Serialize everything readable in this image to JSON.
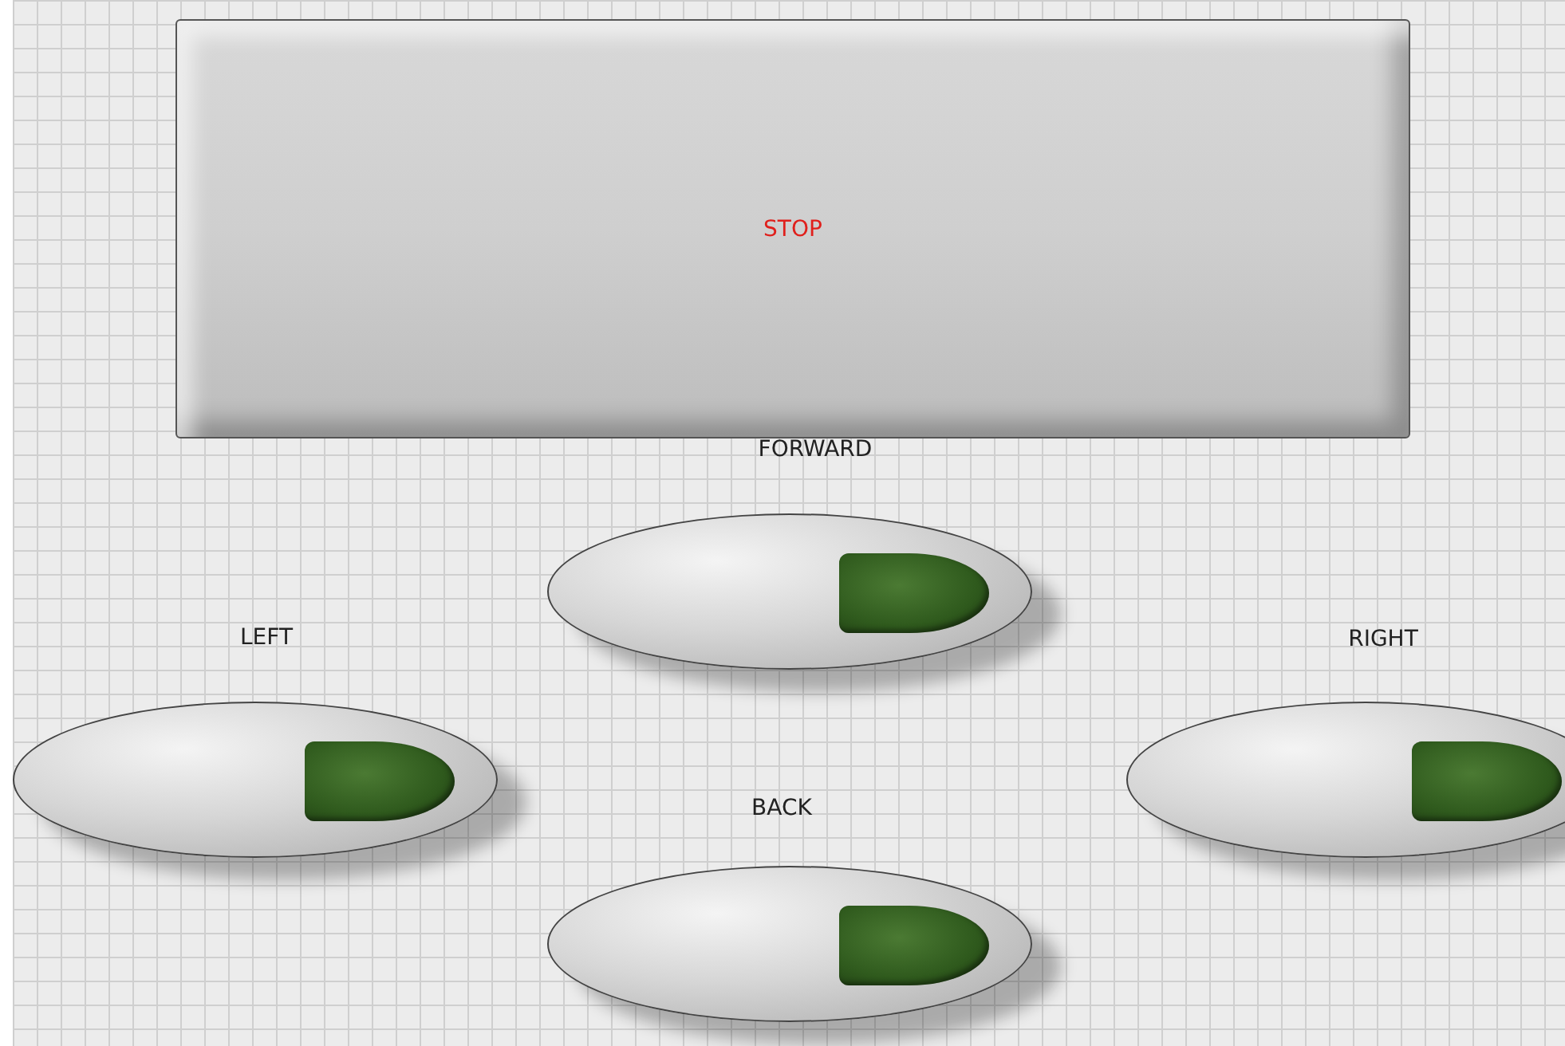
{
  "stop": {
    "label": "STOP"
  },
  "buttons": [
    {
      "label": "FORWARD",
      "on": false
    },
    {
      "label": "LEFT",
      "on": false
    },
    {
      "label": "RIGHT",
      "on": false
    },
    {
      "label": "BACK",
      "on": false
    }
  ]
}
